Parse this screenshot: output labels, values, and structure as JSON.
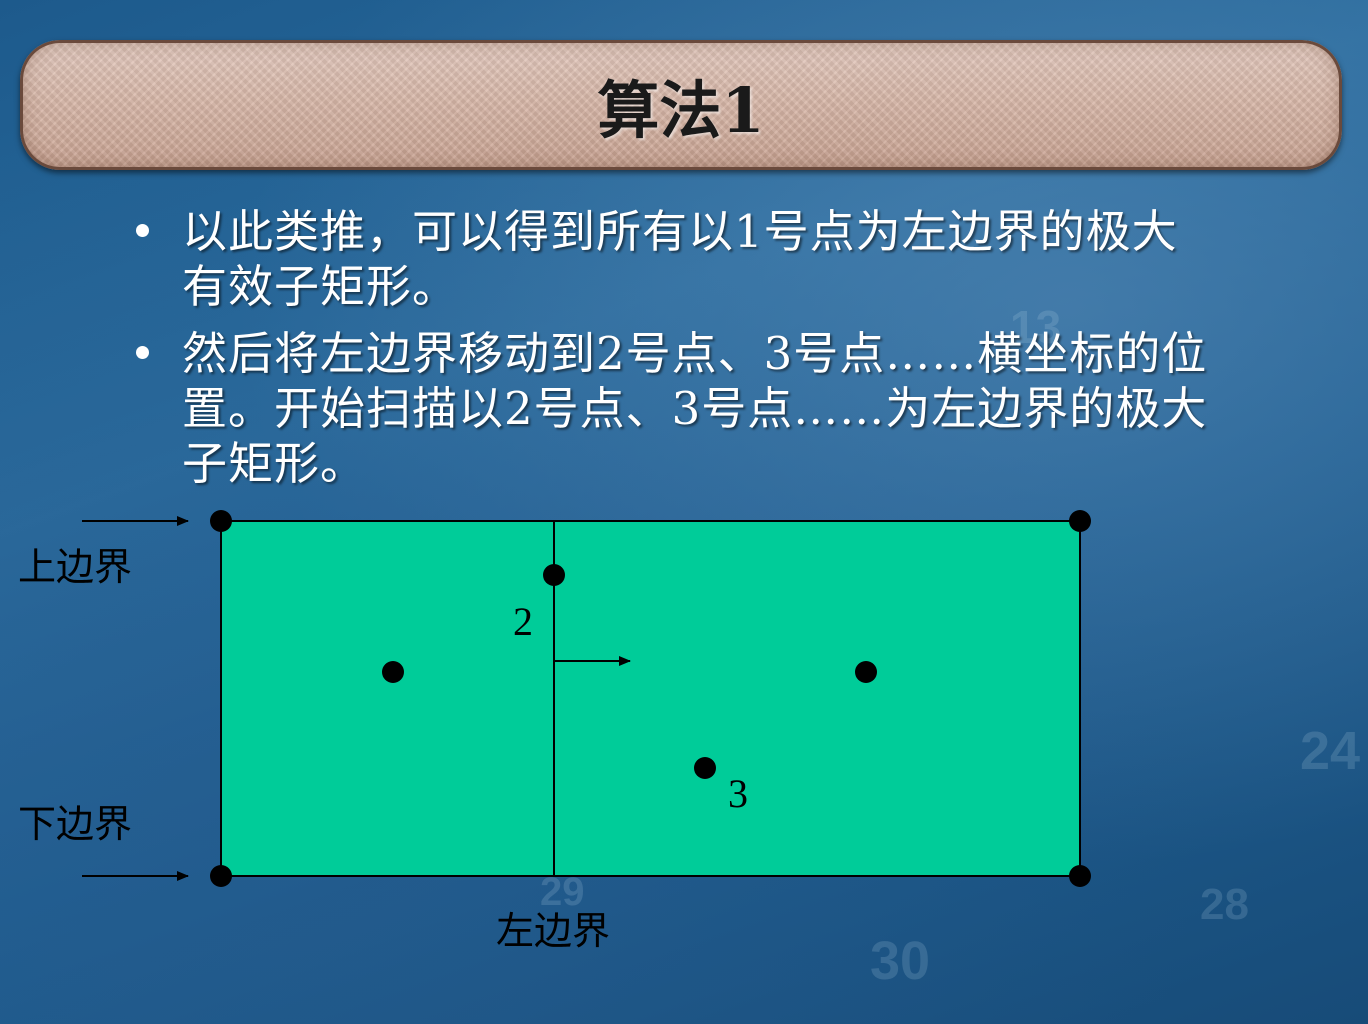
{
  "title": "算法1",
  "bullets": [
    "以此类推，可以得到所有以1号点为左边界的极大有效子矩形。",
    "然后将左边界移动到2号点、3号点……横坐标的位置。开始扫描以2号点、3号点……为左边界的极大子矩形。"
  ],
  "diagram": {
    "top_boundary_label": "上边界",
    "bottom_boundary_label": "下边界",
    "left_boundary_label": "左边界",
    "point_2_label": "2",
    "point_3_label": "3",
    "fill_color": "#00cc99"
  }
}
